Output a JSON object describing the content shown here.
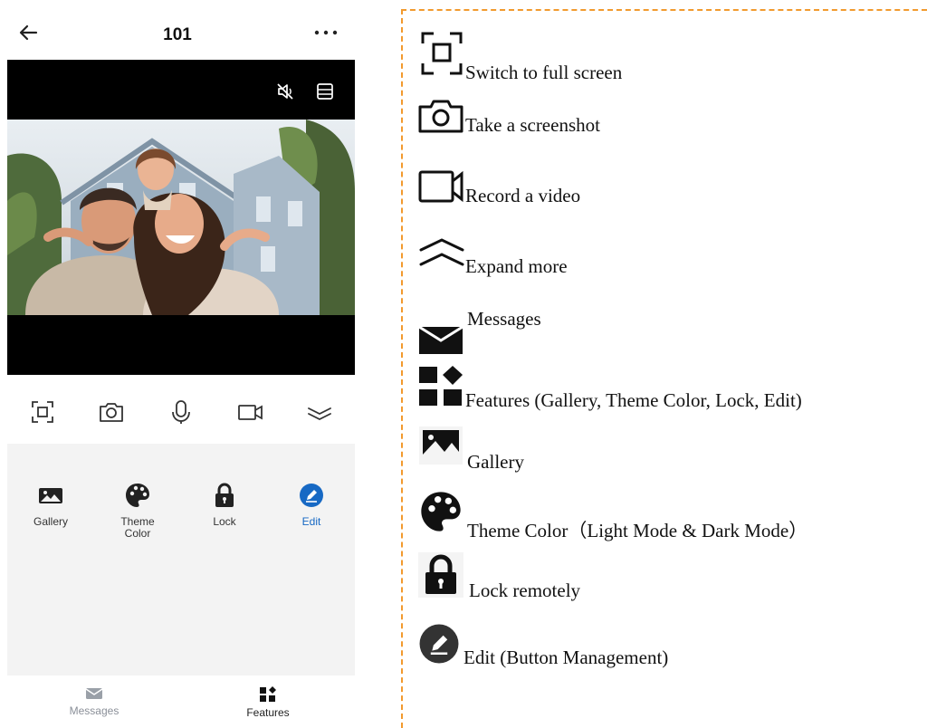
{
  "header": {
    "title": "101",
    "back_icon": "arrow-left-icon",
    "more_icon": "more-horizontal-icon"
  },
  "video": {
    "mute_icon": "speaker-muted-icon",
    "layout_icon": "layout-icon",
    "content": "family-photo"
  },
  "controls": [
    {
      "name": "fullscreen-icon"
    },
    {
      "name": "camera-icon"
    },
    {
      "name": "microphone-icon"
    },
    {
      "name": "video-record-icon"
    },
    {
      "name": "expand-more-icon"
    }
  ],
  "features": {
    "items": [
      {
        "label": "Gallery",
        "icon": "gallery-icon"
      },
      {
        "label": "Theme\nColor",
        "icon": "palette-icon"
      },
      {
        "label": "Lock",
        "icon": "lock-icon"
      },
      {
        "label": "Edit",
        "icon": "edit-icon"
      }
    ]
  },
  "bottom_nav": {
    "items": [
      {
        "label": "Messages",
        "icon": "envelope-icon",
        "active": false
      },
      {
        "label": "Features",
        "icon": "features-grid-icon",
        "active": true
      }
    ]
  },
  "legend": {
    "items": [
      {
        "text": "Switch to full screen",
        "icon": "fullscreen-icon"
      },
      {
        "text": "Take a screenshot",
        "icon": "camera-icon"
      },
      {
        "text": "Record a video",
        "icon": "video-record-icon"
      },
      {
        "text": "Expand more",
        "icon": "expand-more-icon"
      },
      {
        "text": "Messages",
        "icon": "envelope-icon"
      },
      {
        "text": "Features (Gallery, Theme Color, Lock, Edit)",
        "icon": "features-grid-icon"
      },
      {
        "text": "Gallery",
        "icon": "gallery-icon"
      },
      {
        "text": "Theme Color（Light Mode & Dark Mode）",
        "icon": "palette-icon"
      },
      {
        "text": "Lock remotely",
        "icon": "lock-icon"
      },
      {
        "text": "Edit (Button Management)",
        "icon": "edit-icon"
      }
    ]
  },
  "colors": {
    "accent_blue": "#1769c4",
    "divider_orange": "#f29a2e",
    "panel_gray": "#f3f3f3",
    "icon_dark": "#222222",
    "inactive_gray": "#8a8f98"
  }
}
